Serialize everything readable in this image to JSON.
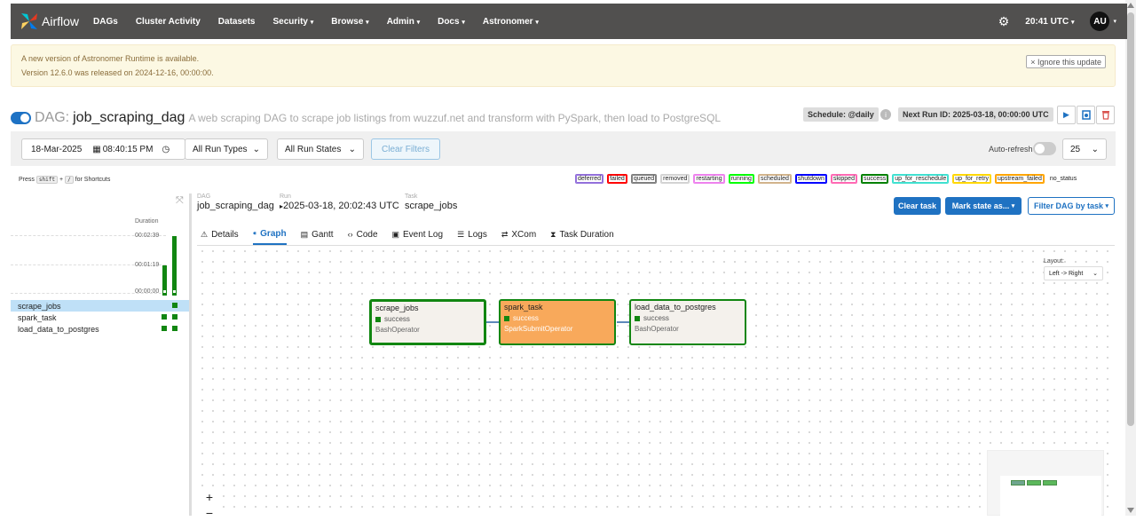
{
  "nav": {
    "logo_text": "Airflow",
    "items": [
      "DAGs",
      "Cluster Activity",
      "Datasets",
      "Security",
      "Browse",
      "Admin",
      "Docs",
      "Astronomer"
    ],
    "time": "20:41 UTC",
    "avatar": "AU"
  },
  "alert": {
    "line1": "A new version of Astronomer Runtime is available.",
    "line2": "Version 12.6.0 was released on 2024-12-16, 00:00:00.",
    "ignore_label": "× Ignore this update"
  },
  "dag": {
    "label": "DAG:",
    "id": "job_scraping_dag",
    "description": "A web scraping DAG to scrape job listings from wuzzuf.net and transform with PySpark, then load to PostgreSQL",
    "schedule": "Schedule: @daily",
    "next_run": "Next Run ID: 2025-03-18, 00:00:00 UTC"
  },
  "filters": {
    "date": "18-Mar-2025",
    "time": "08:40:15 PM",
    "run_types": "All Run Types",
    "run_states": "All Run States",
    "clear_label": "Clear Filters",
    "auto_refresh": "Auto-refresh",
    "num_runs": "25"
  },
  "shortcuts": {
    "press": "Press",
    "key1": "shift",
    "plus": "+",
    "key2": "/",
    "suffix": "for Shortcuts"
  },
  "legend": [
    "deferred",
    "failed",
    "queued",
    "removed",
    "restarting",
    "running",
    "scheduled",
    "shutdown",
    "skipped",
    "success",
    "up_for_reschedule",
    "up_for_retry",
    "upstream_failed",
    "no_status"
  ],
  "legend_colors": {
    "deferred": "#9370db",
    "failed": "#ff0000",
    "queued": "#808080",
    "removed": "#d3d3d3",
    "restarting": "#ee82ee",
    "running": "#00ff00",
    "scheduled": "#d2b48c",
    "shutdown": "#0000ff",
    "skipped": "#ff69b4",
    "success": "#008000",
    "up_for_reschedule": "#40e0d0",
    "up_for_retry": "#ffd700",
    "upstream_failed": "#ffa500",
    "no_status": "#ffffff"
  },
  "grid": {
    "duration_label": "Duration",
    "ticks": [
      "00:02:39",
      "00:01:19",
      "00:00:00"
    ],
    "tasks": [
      "scrape_jobs",
      "spark_task",
      "load_data_to_postgres"
    ]
  },
  "crumbs": {
    "dag_label": "DAG",
    "dag_value": "job_scraping_dag",
    "run_label": "Run",
    "run_value": "2025-03-18, 20:02:43 UTC",
    "task_label": "Task",
    "task_value": "scrape_jobs"
  },
  "actions": {
    "clear_task": "Clear task",
    "mark_state": "Mark state as...",
    "filter_dag": "Filter DAG by task"
  },
  "tabs": [
    "Details",
    "Graph",
    "Gantt",
    "Code",
    "Event Log",
    "Logs",
    "XCom",
    "Task Duration"
  ],
  "graph": {
    "layout_label": "Layout:",
    "layout_value": "Left -> Right",
    "nodes": [
      {
        "name": "scrape_jobs",
        "state": "success",
        "operator": "BashOperator"
      },
      {
        "name": "spark_task",
        "state": "success",
        "operator": "SparkSubmitOperator"
      },
      {
        "name": "load_data_to_postgres",
        "state": "success",
        "operator": "BashOperator"
      }
    ],
    "zoom_in": "+",
    "zoom_out": "−"
  }
}
